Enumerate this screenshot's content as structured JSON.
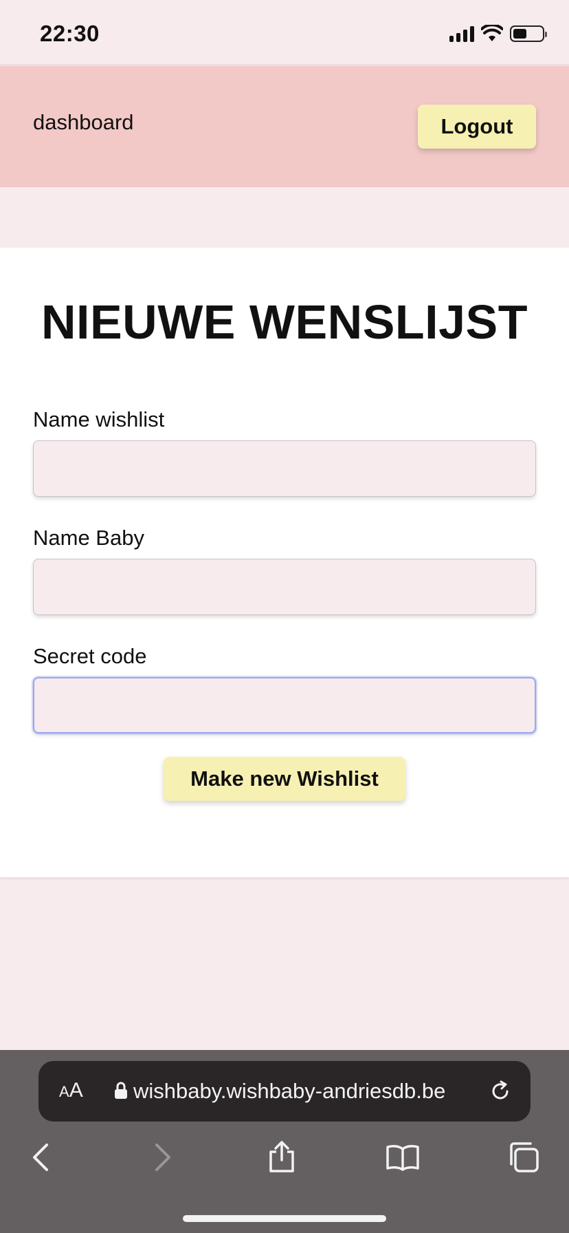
{
  "status_bar": {
    "time": "22:30",
    "icons": [
      "signal-icon",
      "wifi-icon",
      "battery-icon"
    ]
  },
  "header": {
    "nav_link": "dashboard",
    "logout_label": "Logout"
  },
  "form": {
    "title": "NIEUWE WENSLIJST",
    "fields": [
      {
        "label": "Name wishlist",
        "value": "",
        "placeholder": ""
      },
      {
        "label": "Name Baby",
        "value": "",
        "placeholder": ""
      },
      {
        "label": "Secret code",
        "value": "",
        "placeholder": ""
      }
    ],
    "submit_label": "Make new Wishlist"
  },
  "browser": {
    "text_size_label": "AA",
    "url": "wishbaby.wishbaby-andriesdb.be",
    "toolbar_icons": [
      "back-icon",
      "forward-icon",
      "share-icon",
      "bookmarks-icon",
      "tabs-icon"
    ]
  },
  "colors": {
    "page_background": "#f7ebee",
    "header_background": "#f2c9c6",
    "button_background": "#f7f0b3",
    "card_background": "#ffffff",
    "browser_bar": "#646061",
    "url_pill": "#2a2527",
    "focus_ring": "#9aa6ee"
  }
}
